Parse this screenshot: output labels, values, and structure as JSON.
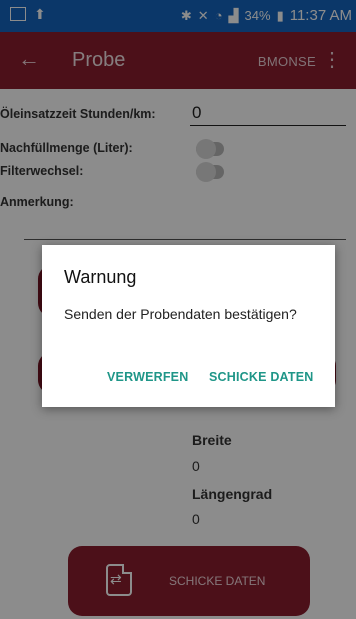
{
  "status_bar": {
    "battery": "34%",
    "time": "11:37 AM"
  },
  "app_bar": {
    "back_icon": "arrow-back-icon",
    "title": "Probe",
    "action_label": "BMONSE",
    "more_icon": "more-vert-icon"
  },
  "form": {
    "oil_time_label": "Öleinsatzzeit Stunden/km:",
    "oil_time_value": "0",
    "refill_label": "Nachfüllmenge (Liter):",
    "refill_toggle": false,
    "filter_label": "Filterwechsel:",
    "filter_toggle": false,
    "remark_label": "Anmerkung:",
    "width_label": "Breite",
    "width_value": "0",
    "longitude_label": "Längengrad",
    "longitude_value": "0"
  },
  "send_button": {
    "label": "SCHICKE DATEN",
    "icon": "document-sync-icon"
  },
  "dialog": {
    "title": "Warnung",
    "message": "Senden der Probendaten bestätigen?",
    "discard_label": "VERWERFEN",
    "confirm_label": "SCHICKE DATEN"
  },
  "colors": {
    "status_bar": "#1565c0",
    "app_bar": "#8b1e2f",
    "dialog_button": "#1f9688"
  }
}
